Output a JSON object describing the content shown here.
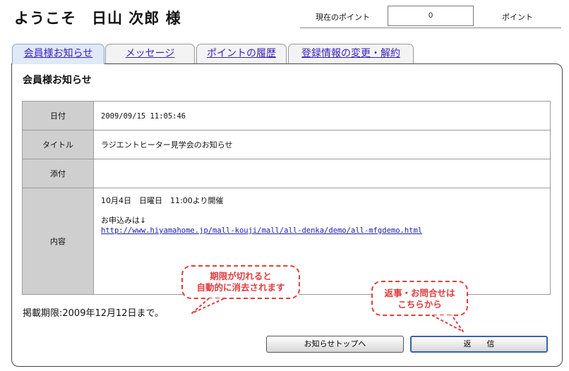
{
  "header": {
    "greeting": "ようこそ　日山 次郎 様",
    "points_label": "現在のポイント",
    "points_value": "0",
    "points_unit": "ポイント"
  },
  "tabs": [
    {
      "label": "会員様お知らせ",
      "active": true
    },
    {
      "label": "メッセージ",
      "active": false
    },
    {
      "label": "ポイントの履歴",
      "active": false
    },
    {
      "label": "登録情報の変更・解約",
      "active": false
    }
  ],
  "panel": {
    "title": "会員様お知らせ",
    "rows": {
      "date_label": "日付",
      "date_value": "2009/09/15 11:05:46",
      "title_label": "タイトル",
      "title_value": "ラジエントヒーター見学会のお知らせ",
      "attachment_label": "添付",
      "attachment_value": "",
      "content_label": "内容",
      "content_line1": "10月4日　日曜日　11:00より開催",
      "content_line2": "お申込みは↓",
      "content_link": "http://www.hiyamahome.jp/mall-kouji/mall/all-denka/demo/all-mfgdemo.html"
    },
    "expiry": "掲載期限:2009年12月12日まで。"
  },
  "buttons": {
    "back_top": "お知らせトップへ",
    "reply": "返　　信"
  },
  "callouts": {
    "expire_line1": "期限が切れると",
    "expire_line2": "自動的に消去されます",
    "reply_line1": "返事・お問合せは",
    "reply_line2": "こちらから"
  },
  "colors": {
    "callout": "#e23c3c",
    "link": "#3a1fbf",
    "active_tab": "#dfe9f7",
    "header_cell": "#cfcfcf"
  }
}
